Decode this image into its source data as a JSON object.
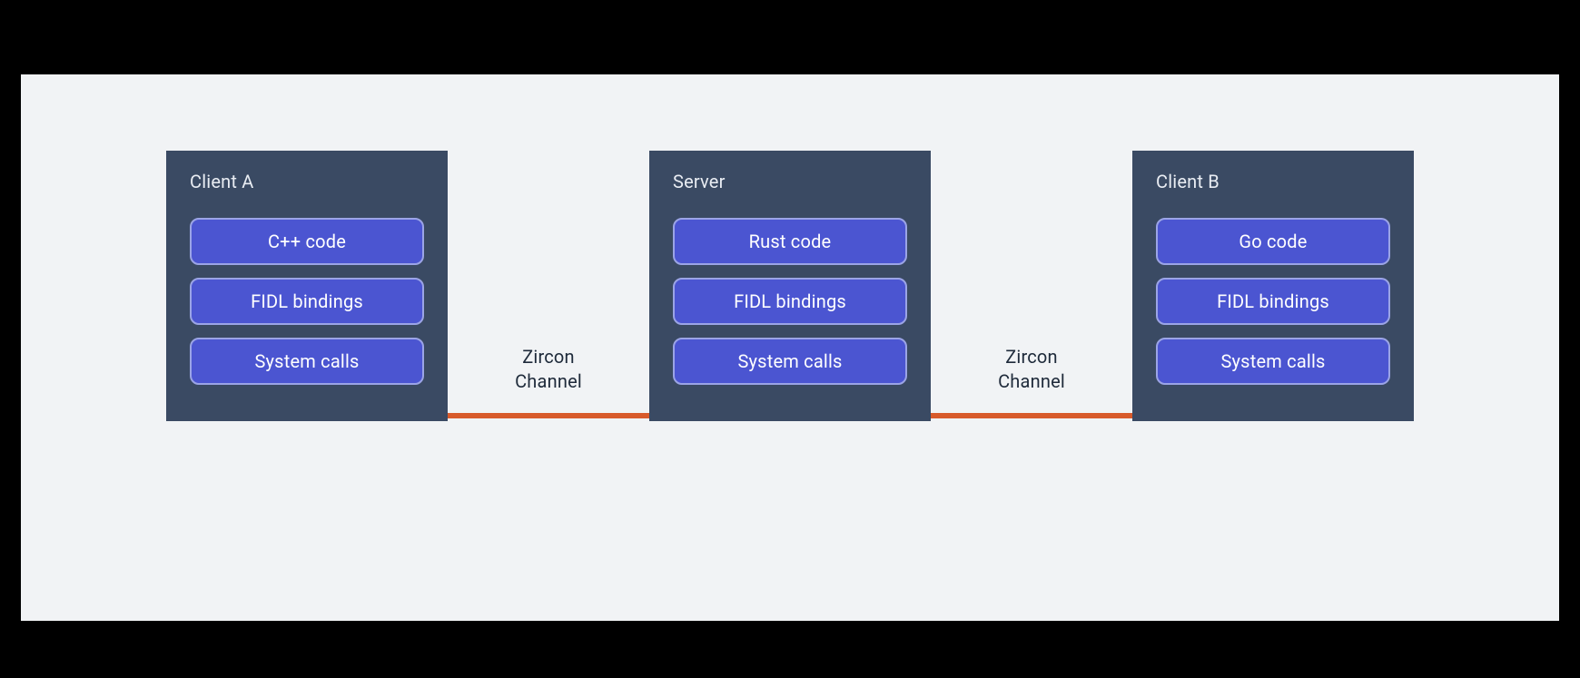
{
  "colors": {
    "page_bg": "#000000",
    "canvas_bg": "#f1f3f5",
    "box_bg": "#3a4a63",
    "layer_bg": "#4b55d1",
    "layer_border": "#9ba4e6",
    "channel_line": "#d85a2b",
    "text_dark": "#1e2a3a",
    "text_light": "#e9edf3"
  },
  "channels": [
    {
      "label_line1": "Zircon",
      "label_line2": "Channel"
    },
    {
      "label_line1": "Zircon",
      "label_line2": "Channel"
    }
  ],
  "boxes": [
    {
      "title": "Client A",
      "layers": [
        "C++ code",
        "FIDL bindings",
        "System calls"
      ]
    },
    {
      "title": "Server",
      "layers": [
        "Rust code",
        "FIDL bindings",
        "System calls"
      ]
    },
    {
      "title": "Client B",
      "layers": [
        "Go code",
        "FIDL bindings",
        "System calls"
      ]
    }
  ]
}
